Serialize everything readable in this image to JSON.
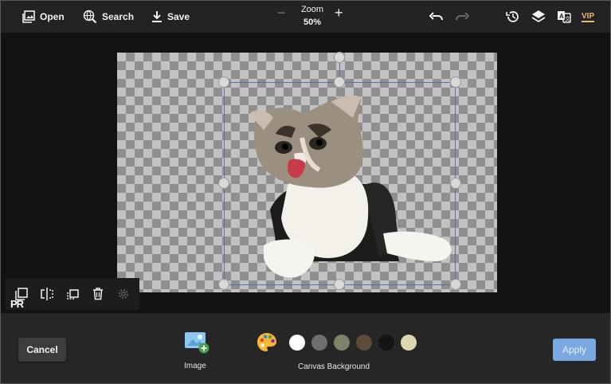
{
  "toolbar": {
    "open_label": "Open",
    "search_label": "Search",
    "save_label": "Save",
    "zoom_label": "Zoom",
    "zoom_value": "50%",
    "zoom_out_icon": "minus-icon",
    "zoom_in_icon": "plus-icon",
    "undo_icon": "undo-icon",
    "redo_icon": "redo-icon",
    "history_icon": "history-icon",
    "layers_icon": "layers-icon",
    "translate_icon": "translate-icon",
    "vip_label": "VIP"
  },
  "mini_toolbar": {
    "items": [
      "duplicate-icon",
      "flip-icon",
      "layer-order-icon",
      "delete-icon",
      "settings-icon"
    ],
    "watermark": "PR"
  },
  "bottom": {
    "cancel_label": "Cancel",
    "apply_label": "Apply",
    "image_label": "Image",
    "canvas_background_label": "Canvas Background",
    "swatches": [
      "#ffffff",
      "#6f6f6f",
      "#7e8269",
      "#5e4b3a",
      "#141414",
      "#ddd6b0"
    ]
  },
  "colors": {
    "accent": "#7aa8e0",
    "vip": "#e2b873",
    "selection": "#5b6fa8"
  }
}
